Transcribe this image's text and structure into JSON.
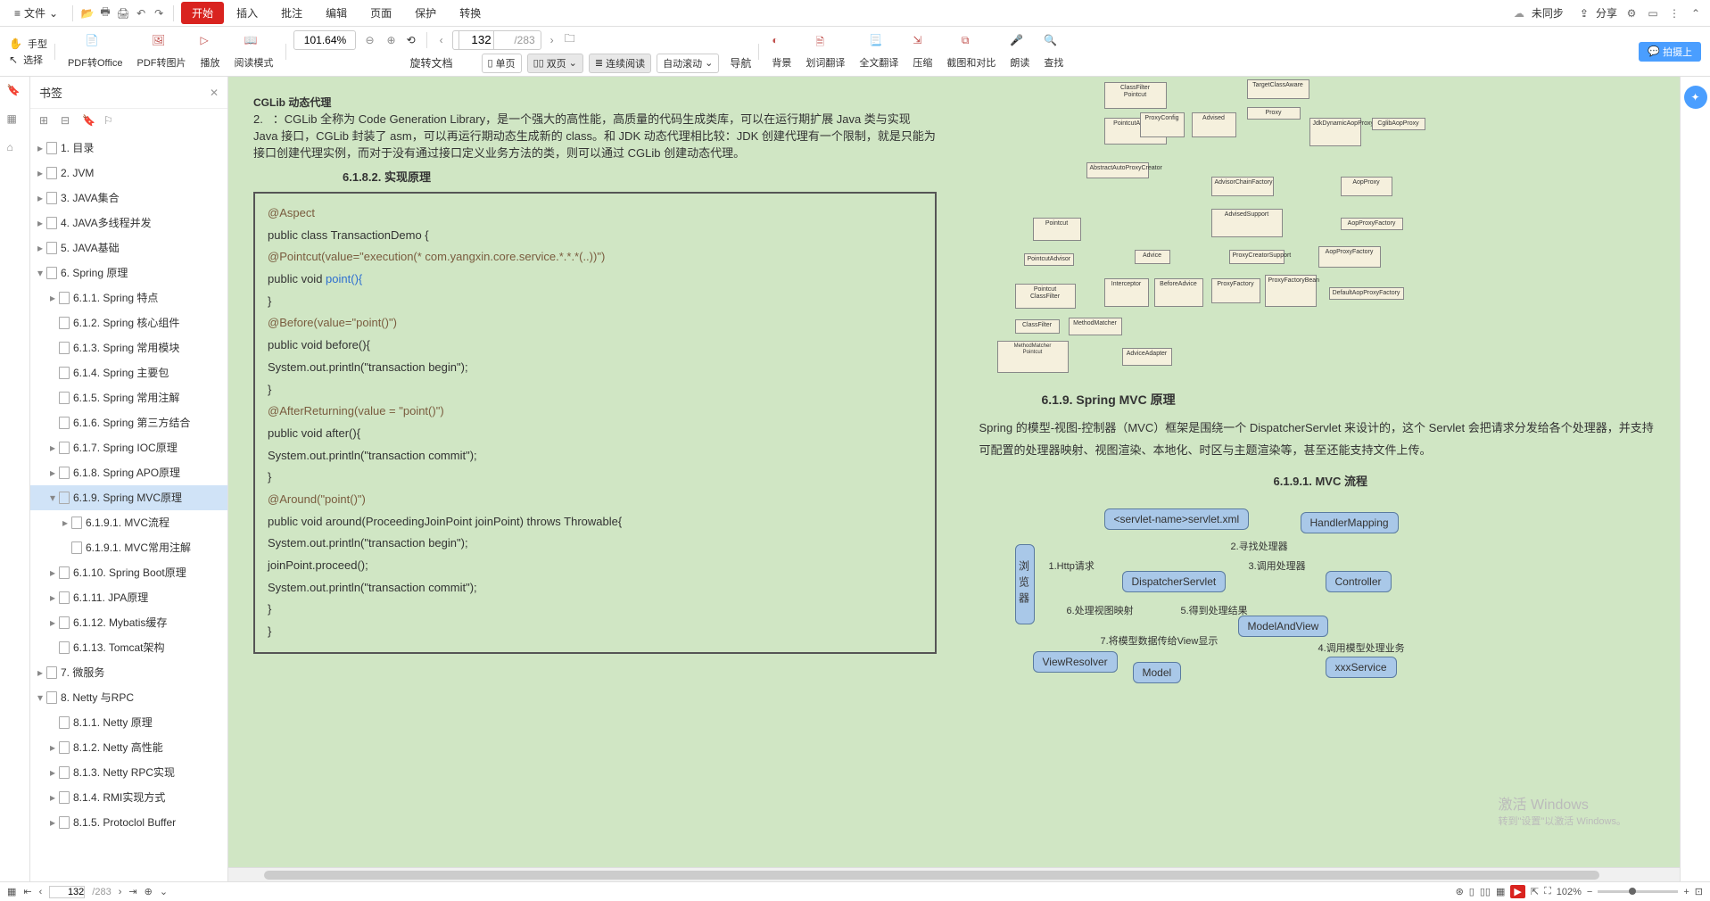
{
  "menu": {
    "file": "文件",
    "tabs": [
      "开始",
      "插入",
      "批注",
      "编辑",
      "页面",
      "保护",
      "转换"
    ],
    "sync": "未同步",
    "share": "分享"
  },
  "toolbar": {
    "hand": "手型",
    "select": "选择",
    "pdf_office": "PDF转Office",
    "pdf_image": "PDF转图片",
    "play": "播放",
    "read_mode": "阅读模式",
    "zoom": "101.64%",
    "rotate": "旋转文档",
    "page_current": "132",
    "page_total": "/283",
    "single": "单页",
    "double": "双页",
    "continuous": "连续阅读",
    "autoscroll": "自动滚动",
    "navigate": "导航",
    "background": "背景",
    "word_translate": "划词翻译",
    "full_translate": "全文翻译",
    "compress": "压缩",
    "screenshot": "截图和对比",
    "read_aloud": "朗读",
    "find": "查找",
    "discuss": "拍摄上"
  },
  "sidebar": {
    "title": "书签",
    "items": [
      {
        "txt": "1. 目录",
        "depth": 0,
        "expand": "▸"
      },
      {
        "txt": "2. JVM",
        "depth": 0,
        "expand": "▸"
      },
      {
        "txt": "3. JAVA集合",
        "depth": 0,
        "expand": "▸"
      },
      {
        "txt": "4. JAVA多线程并发",
        "depth": 0,
        "expand": "▸"
      },
      {
        "txt": "5. JAVA基础",
        "depth": 0,
        "expand": "▸"
      },
      {
        "txt": "6. Spring 原理",
        "depth": 0,
        "expand": "▾"
      },
      {
        "txt": "6.1.1. Spring 特点",
        "depth": 1,
        "expand": "▸"
      },
      {
        "txt": "6.1.2. Spring 核心组件",
        "depth": 1,
        "expand": ""
      },
      {
        "txt": "6.1.3. Spring 常用模块",
        "depth": 1,
        "expand": ""
      },
      {
        "txt": "6.1.4. Spring 主要包",
        "depth": 1,
        "expand": ""
      },
      {
        "txt": "6.1.5. Spring 常用注解",
        "depth": 1,
        "expand": ""
      },
      {
        "txt": "6.1.6. Spring 第三方结合",
        "depth": 1,
        "expand": ""
      },
      {
        "txt": "6.1.7. Spring IOC原理",
        "depth": 1,
        "expand": "▸"
      },
      {
        "txt": "6.1.8. Spring APO原理",
        "depth": 1,
        "expand": "▸"
      },
      {
        "txt": "6.1.9. Spring MVC原理",
        "depth": 1,
        "expand": "▾",
        "sel": true
      },
      {
        "txt": "6.1.9.1. MVC流程",
        "depth": 2,
        "expand": "▸"
      },
      {
        "txt": "6.1.9.1. MVC常用注解",
        "depth": 2,
        "expand": ""
      },
      {
        "txt": "6.1.10. Spring Boot原理",
        "depth": 1,
        "expand": "▸"
      },
      {
        "txt": "6.1.11. JPA原理",
        "depth": 1,
        "expand": "▸"
      },
      {
        "txt": "6.1.12. Mybatis缓存",
        "depth": 1,
        "expand": "▸"
      },
      {
        "txt": "6.1.13. Tomcat架构",
        "depth": 1,
        "expand": ""
      },
      {
        "txt": "7.  微服务",
        "depth": 0,
        "expand": "▸"
      },
      {
        "txt": "8. Netty 与RPC",
        "depth": 0,
        "expand": "▾"
      },
      {
        "txt": "8.1.1. Netty 原理",
        "depth": 1,
        "expand": ""
      },
      {
        "txt": "8.1.2. Netty 高性能",
        "depth": 1,
        "expand": "▸"
      },
      {
        "txt": "8.1.3. Netty RPC实现",
        "depth": 1,
        "expand": "▸"
      },
      {
        "txt": "8.1.4. RMI实现方式",
        "depth": 1,
        "expand": "▸"
      },
      {
        "txt": "8.1.5. Protoclol Buffer",
        "depth": 1,
        "expand": "▸"
      }
    ]
  },
  "page1": {
    "top_hdr": "CGLib 动态代理",
    "num": "2.",
    "text_pre": "：CGLib 全称为 Code Generation Library，是一个强大的高性能，",
    "link1": "高质量的代码生成类库，可以在运行期扩展 Java 类与实现 Java 接口，",
    "text_post": "CGLib 封装了 asm，可以再运行期动态生成新的 class。和 JDK 动态代理相比较：JDK 创建代理有一个限制，就是只能为接口创建代理实例，而对于没有通过接口定义业务方法的类，则可以通过 CGLib 创建动态代理。",
    "hdr": "6.1.8.2.    实现原理",
    "code": [
      {
        "t": "@Aspect",
        "c": "anno"
      },
      {
        "t": "public class TransactionDemo {",
        "c": ""
      },
      {
        "t": "        @Pointcut(value=\"execution(* com.yangxin.core.service.*.*.*(..))\")",
        "c": "anno"
      },
      {
        "t": "    public void ",
        "c": "",
        "tail": "point(){",
        "tc": "kw"
      },
      {
        "t": "        }",
        "c": ""
      },
      {
        "t": "     @Before(value=\"point()\")",
        "c": "anno"
      },
      {
        "t": "    public void before(){",
        "c": ""
      },
      {
        "t": "         System.out.println(\"transaction begin\");",
        "c": ""
      },
      {
        "t": "    }",
        "c": ""
      },
      {
        "t": "      @AfterReturning(value = \"point()\")",
        "c": "anno"
      },
      {
        "t": "    public void after(){",
        "c": ""
      },
      {
        "t": "         System.out.println(\"transaction commit\");",
        "c": ""
      },
      {
        "t": "    }",
        "c": ""
      },
      {
        "t": "         @Around(\"point()\")",
        "c": "anno"
      },
      {
        "t": "    public void around(ProceedingJoinPoint joinPoint) throws Throwable{",
        "c": ""
      },
      {
        "t": "         System.out.println(\"transaction begin\");",
        "c": ""
      },
      {
        "t": "         joinPoint.proceed();",
        "c": ""
      },
      {
        "t": "         System.out.println(\"transaction commit\");",
        "c": ""
      },
      {
        "t": "     }",
        "c": ""
      },
      {
        "t": "}",
        "c": ""
      }
    ]
  },
  "page2": {
    "h2": "6.1.9.  Spring MVC 原理",
    "para": "Spring 的模型-视图-控制器（MVC）框架是围绕一个 DispatcherServlet 来设计的，这个 Servlet 会把请求分发给各个处理器，并支持可配置的处理器映射、视图渲染、本地化、时区与主题渲染等，甚至还能支持文件上传。",
    "h3": "6.1.9.1.    MVC 流程",
    "mvc": {
      "browser": "浏览器",
      "servlet_xml": "<servlet-name>servlet.xml",
      "handler_mapping": "HandlerMapping",
      "dispatcher": "DispatcherServlet",
      "controller": "Controller",
      "model_view": "ModelAndView",
      "view_resolver": "ViewResolver",
      "model": "Model",
      "xxx_service": "xxxService",
      "l1": "1.Http请求",
      "l2": "2.寻找处理器",
      "l3": "3.调用处理器",
      "l5": "5.得到处理结果",
      "l6": "6.处理视图映射",
      "l7": "7.将模型数据传给View显示",
      "l8": "4.调用模型处理业务"
    }
  },
  "status": {
    "page": "132",
    "total": "/283",
    "zoom": "102%"
  },
  "watermark": {
    "l1": "激活 Windows",
    "l2": "转到\"设置\"以激活 Windows。"
  }
}
